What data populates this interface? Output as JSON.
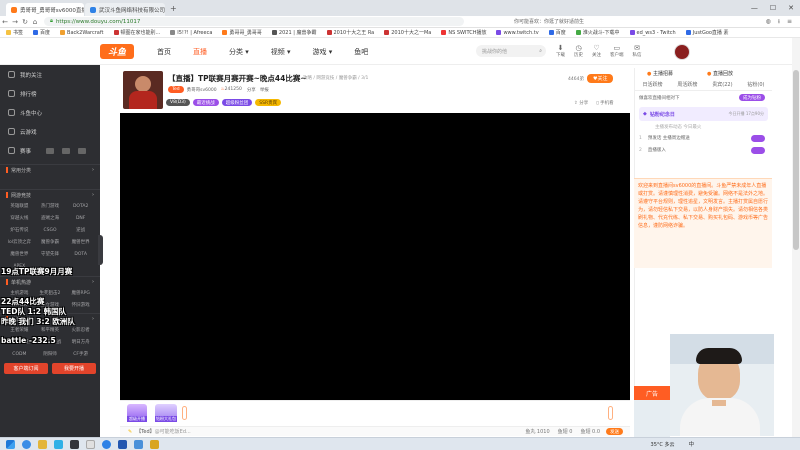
{
  "browser": {
    "tabs": [
      {
        "title": "勇哥哥_勇哥哥sv6000直播间_11017",
        "active": true
      },
      {
        "title": "武汉斗鱼网络科技有限公司 | 11017",
        "active": false
      }
    ],
    "new_tab": "+",
    "url": "https://www.douyu.com/11017",
    "address_hint": "你可能喜欢：你逛了就好适前生",
    "bookmarks": [
      "书签",
      "百度",
      "Back2Warcraft",
      "顿图在家也能别...",
      "I5!?! | Afreeca",
      "勇哥哥_勇哥哥",
      "2021 | 魔兽争霸",
      "2010十大之王 Ra",
      "2010十大之一Ma",
      "NS SWITCH播放",
      "www.twitch.tv",
      "百度",
      "淮火战斗-下载中",
      "ed_ws3 - Twitch",
      "JustGoo直播 素"
    ]
  },
  "header": {
    "logo": "斗鱼",
    "nav": [
      "首页",
      "直播",
      "分类",
      "视频",
      "游戏",
      "鱼吧"
    ],
    "active_nav": "直播",
    "search_placeholder": "挑战你的他",
    "user_actions": [
      "下载",
      "历史",
      "关注",
      "客户端",
      "私信"
    ]
  },
  "sidebar": {
    "main": [
      "我的关注",
      "排行榜",
      "斗鱼中心",
      "云游戏",
      "赛事"
    ],
    "section_hot": "常用分类",
    "section_net": "网游竞技",
    "net_items": [
      "英雄联盟",
      "热门游戏",
      "DOTA2",
      "穿越火线",
      "盗贼之海",
      "DNF",
      "炉石传说",
      "CSGO",
      "逆战",
      "lol云顶之弈",
      "魔兽争霸",
      "魔兽世界",
      "魔兽世界",
      "守望先锋",
      "DOTA",
      "APEX"
    ],
    "section_single": "单机热游",
    "single_items": [
      "主机游戏",
      "生死狙击2",
      "魔兽RPG",
      "NBA2K",
      "独立游戏",
      "怀旧游戏"
    ],
    "section_mobile": "手游休闲",
    "mobile_items": [
      "王者荣耀",
      "和平精英",
      "火影忍者",
      "DOTA手游",
      "金铲铲之战",
      "明日方舟",
      "CODM",
      "阴阳师",
      "CF手游"
    ],
    "client_btn": "客户端订阅",
    "open_btn": "我要开播"
  },
  "overlay": {
    "line1": "19点TP联赛9月月赛",
    "line2": "22点44比赛",
    "line3": "TED队   1:2 韩国队",
    "line4": "昨晚 我们 3:2 欧洲队",
    "line5": "battle -232.5"
  },
  "room": {
    "title": "【直播】TP联赛月赛开赛~晚点44比赛~",
    "breadcrumb": "攻略 / 网游竞技 / 魔兽争霸 / 3/1",
    "streamer_tag": "Ted",
    "streamer_name": "勇哥哥sv6000",
    "popularity": "241250",
    "actions": [
      "分享",
      "举报"
    ],
    "badges": [
      "V8(D3)",
      "最近挑战",
      "超级粉丝团",
      "SSR贵宾"
    ],
    "follow_count": "4464弟",
    "follow_btn": "关注",
    "share": "分享",
    "phone": "手机看"
  },
  "below_video": {
    "gift_labels": [
      "超级开播",
      "钻粉大礼包"
    ],
    "input_prefix": "【Ted】",
    "input_placeholder": "@可能吃饭Ed...",
    "stats": [
      "鱼丸 1010",
      "鱼翅 0",
      "鱼翅 0.0"
    ],
    "send_btn": "发送"
  },
  "right_panel": {
    "top_tabs": [
      "主播招募",
      "直播回放"
    ],
    "tabs": [
      "日活跃榜",
      "周活跃榜",
      "贵宾(22)",
      "钻粉(0)"
    ],
    "vip_label": "做喜欢直播间相对下",
    "vip_btn": "成为钻粉",
    "fans_title": "钻粉纪念日",
    "fans_sub": "今日开播 17点90分",
    "rank_hint": "主播发布动态 今日最火",
    "rank_rows": [
      "预发话 主播周边赠送",
      "直播版入"
    ],
    "notice": "欢迎来到直播间sv6000的直播间。斗鱼严禁未成年人直播或打赏。请谨慎理性消费，避免受骗。网络不是法外之地。请遵守平台规则，理性追星，文明发言。主播打赏属自愿行为，请勿轻信私下交易，以防人身财产损失。请勿相信各类刷礼物、代充代练、私下交易、购买礼包码、游戏币等广告信息，谨防网络诈骗。"
  },
  "webcam": {
    "label": "广告"
  },
  "taskbar": {
    "weather": "35°C 多云",
    "time": "",
    "lang": "中"
  },
  "colors": {
    "brand": "#ff5d23",
    "sidebar": "#2d2e32",
    "notice_bg": "#fff5ec"
  }
}
